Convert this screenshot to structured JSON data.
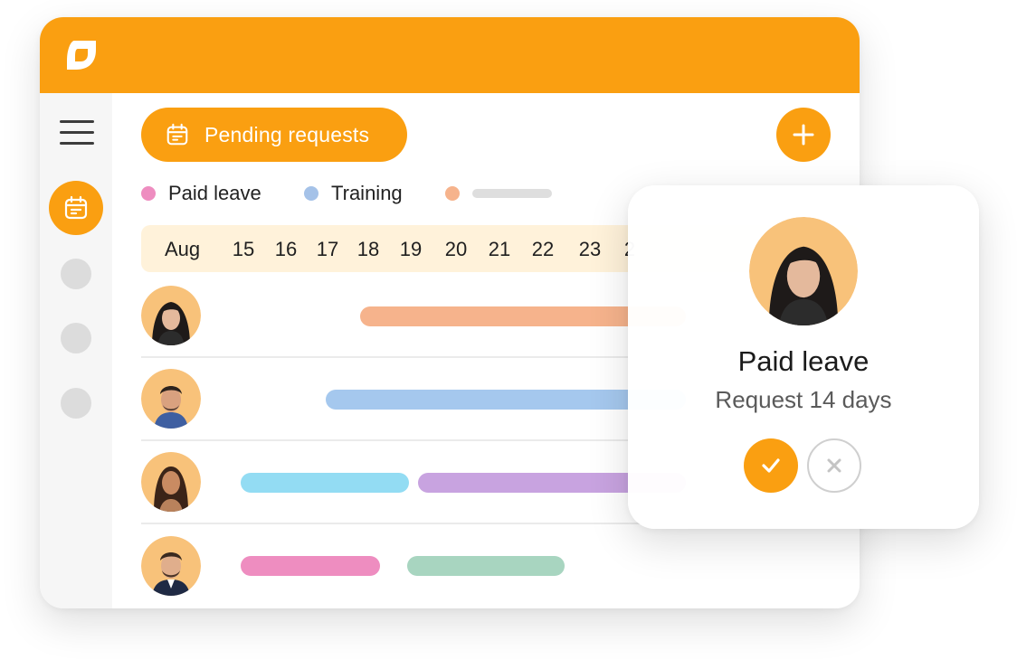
{
  "toolbar": {
    "pending_label": "Pending requests"
  },
  "legend": [
    {
      "label": "Paid leave",
      "color": "#ee8dc0"
    },
    {
      "label": "Training",
      "color": "#a5c2e8"
    },
    {
      "label": "",
      "color": "#f6b38c"
    }
  ],
  "calendar": {
    "month": "Aug",
    "days": [
      "15",
      "16",
      "17",
      "18",
      "19",
      "20",
      "21",
      "22",
      "23",
      "2"
    ]
  },
  "rows": [
    {
      "bars": [
        {
          "color": "#f6b38c"
        }
      ]
    },
    {
      "bars": [
        {
          "color": "#a5c8ee"
        }
      ]
    },
    {
      "bars": [
        {
          "color": "#93dcf3"
        },
        {
          "color": "#c8a3e0"
        }
      ]
    },
    {
      "bars": [
        {
          "color": "#ee8dc0"
        },
        {
          "color": "#a8d5c0"
        }
      ]
    }
  ],
  "popup": {
    "title": "Paid leave",
    "subtitle": "Request 14 days"
  },
  "colors": {
    "accent": "#fa9f11",
    "sidebar": "#f6f6f6",
    "datebar": "#fff2da"
  },
  "icons": [
    "logo-icon",
    "menu-icon",
    "calendar-icon",
    "plus-icon",
    "check-icon",
    "close-icon"
  ]
}
